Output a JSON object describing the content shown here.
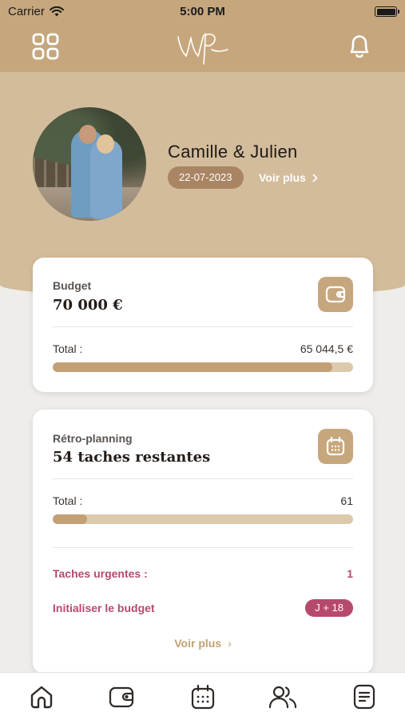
{
  "status_bar": {
    "carrier": "Carrier",
    "time": "5:00 PM"
  },
  "header": {
    "menu_icon": "grid-menu-icon",
    "logo_text": "Wp",
    "bell_icon": "bell-icon"
  },
  "profile": {
    "couple_name": "Camille & Julien",
    "date": "22-07-2023",
    "more_label": "Voir plus"
  },
  "budget": {
    "label": "Budget",
    "amount": "70 000 €",
    "total_label": "Total :",
    "total_value": "65 044,5 €",
    "progress": 0.93,
    "icon": "wallet-icon"
  },
  "planning": {
    "label": "Rétro-planning",
    "remaining": "54 taches restantes",
    "total_label": "Total :",
    "total_value": "61",
    "progress": 0.115,
    "icon": "calendar-icon",
    "urgent_label": "Taches urgentes :",
    "urgent_value": "1",
    "init_label": "Initialiser le budget",
    "init_badge": "J + 18",
    "more_label": "Voir plus"
  },
  "tabs": [
    "home-icon",
    "wallet-icon",
    "calendar-icon",
    "users-icon",
    "list-icon"
  ],
  "colors": {
    "accent": "#c6a77d",
    "accent_dark": "#a98564",
    "alert": "#b64a6c",
    "bar_bg": "#ddc9ac"
  }
}
